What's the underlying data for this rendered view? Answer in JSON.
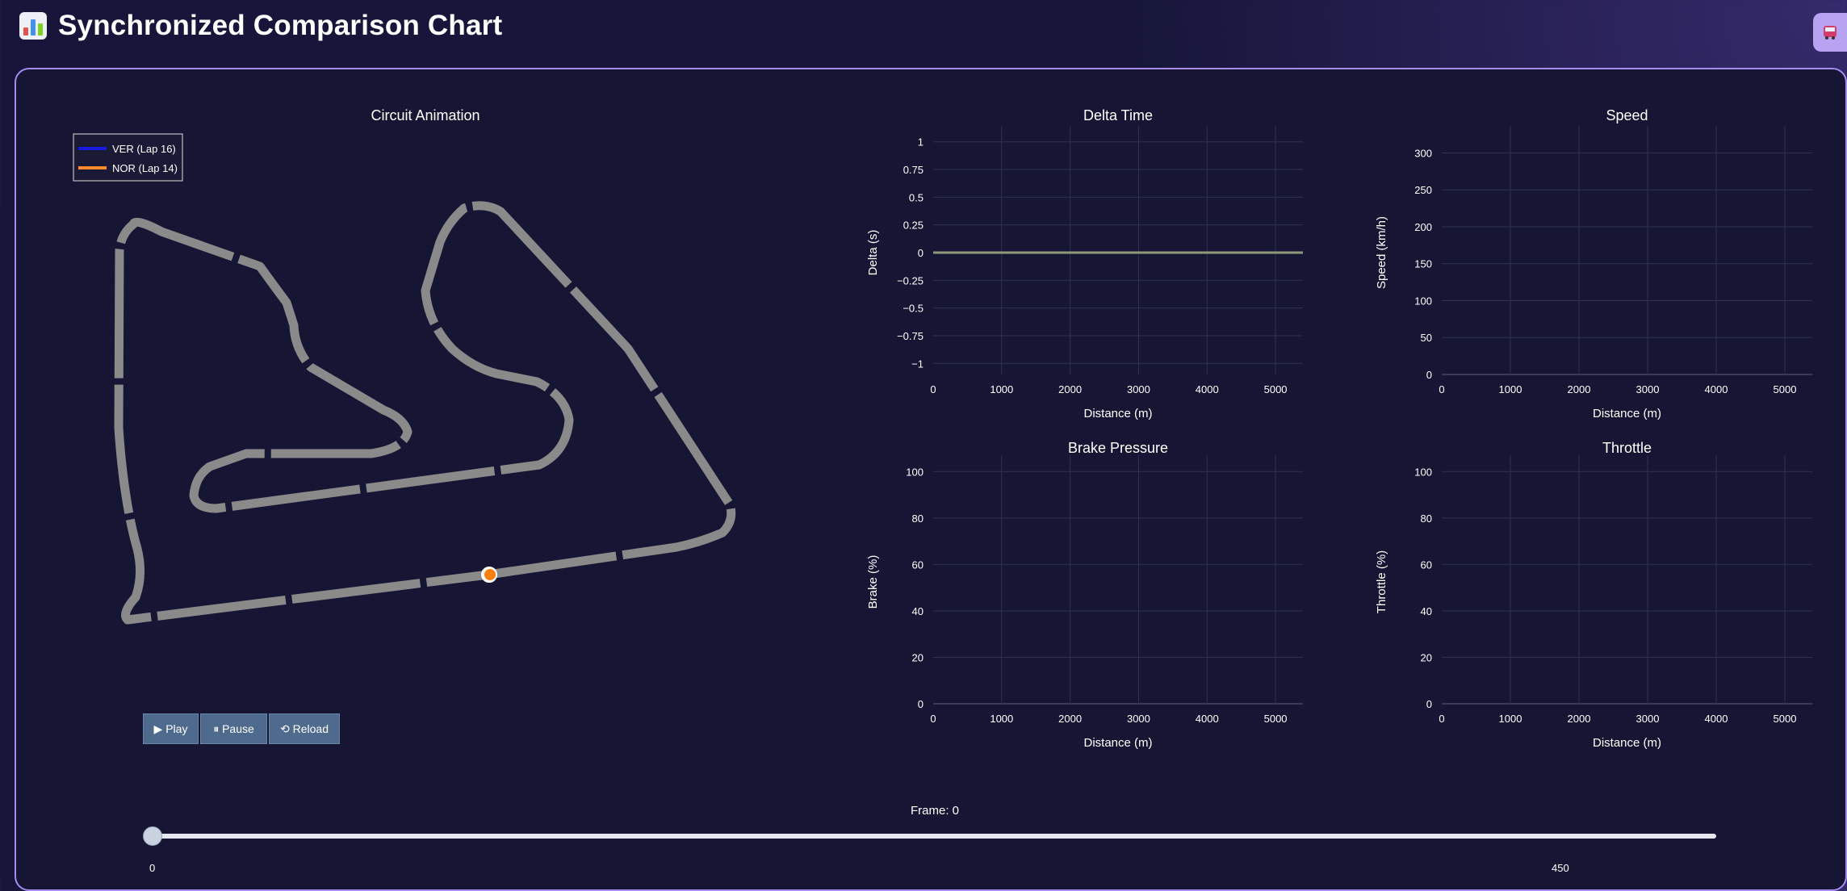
{
  "header": {
    "title": "Synchronized Comparison Chart",
    "icon": "bar-chart-emoji-icon"
  },
  "circuit": {
    "title": "Circuit Animation",
    "legend": [
      {
        "label": "VER (Lap 16)",
        "color": "#1a1adf"
      },
      {
        "label": "NOR (Lap 14)",
        "color": "#ff8a2a"
      }
    ],
    "track_color": "#8a8a8a",
    "marker_colors": {
      "VER": "#1a1adf",
      "NOR": "#ff7f0e"
    }
  },
  "controls": {
    "play": "▶ Play",
    "pause": "⏸ Pause",
    "reload": "⟲ Reload"
  },
  "slider": {
    "label": "Frame: 0",
    "min_label": "0",
    "max_label": "450",
    "value": 0,
    "max": 450
  },
  "chart_data": [
    {
      "type": "line",
      "title": "Delta Time",
      "xlabel": "Distance (m)",
      "ylabel": "Delta (s)",
      "xlim": [
        0,
        5400
      ],
      "ylim": [
        -1.1,
        1.1
      ],
      "xticks": [
        0,
        1000,
        2000,
        3000,
        4000,
        5000
      ],
      "yticks": [
        1,
        0.75,
        0.5,
        0.25,
        0,
        -0.25,
        -0.5,
        -0.75,
        -1
      ],
      "ytick_labels": [
        "1",
        "0.75",
        "0.5",
        "0.25",
        "0",
        "−0.25",
        "−0.5",
        "−0.75",
        "−1"
      ],
      "series": [
        {
          "x": [
            0,
            5400
          ],
          "y": [
            0,
            0
          ],
          "color": "#8c9a7a"
        }
      ]
    },
    {
      "type": "line",
      "title": "Speed",
      "xlabel": "Distance (m)",
      "ylabel": "Speed (km/h)",
      "xlim": [
        0,
        5400
      ],
      "ylim": [
        0,
        330
      ],
      "xticks": [
        0,
        1000,
        2000,
        3000,
        4000,
        5000
      ],
      "yticks": [
        300,
        250,
        200,
        150,
        100,
        50,
        0
      ],
      "series": []
    },
    {
      "type": "line",
      "title": "Brake Pressure",
      "xlabel": "Distance (m)",
      "ylabel": "Brake (%)",
      "xlim": [
        0,
        5400
      ],
      "ylim": [
        0,
        105
      ],
      "xticks": [
        0,
        1000,
        2000,
        3000,
        4000,
        5000
      ],
      "yticks": [
        100,
        80,
        60,
        40,
        20,
        0
      ],
      "series": []
    },
    {
      "type": "line",
      "title": "Throttle",
      "xlabel": "Distance (m)",
      "ylabel": "Throttle (%)",
      "xlim": [
        0,
        5400
      ],
      "ylim": [
        0,
        105
      ],
      "xticks": [
        0,
        1000,
        2000,
        3000,
        4000,
        5000
      ],
      "yticks": [
        100,
        80,
        60,
        40,
        20,
        0
      ],
      "series": []
    }
  ]
}
